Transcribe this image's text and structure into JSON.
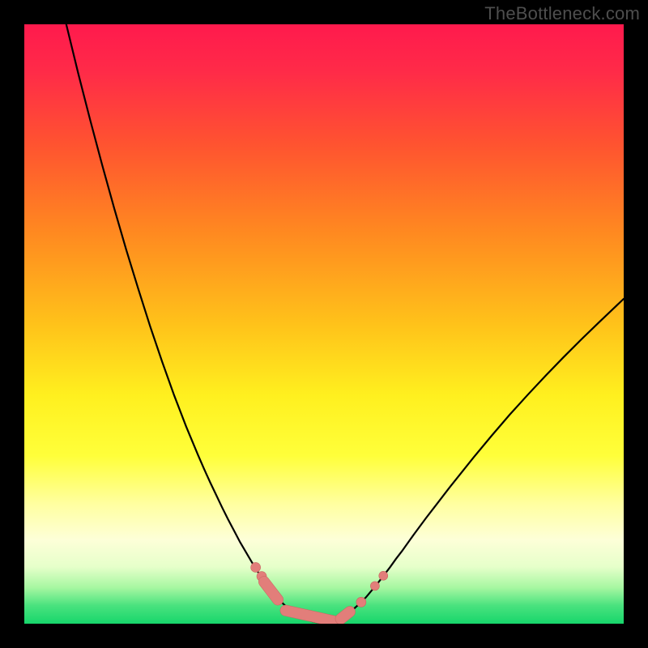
{
  "watermark": "TheBottleneck.com",
  "colors": {
    "frame": "#000000",
    "gradient_stops": [
      {
        "offset": 0.0,
        "color": "#ff1a4d"
      },
      {
        "offset": 0.08,
        "color": "#ff2b48"
      },
      {
        "offset": 0.2,
        "color": "#ff5330"
      },
      {
        "offset": 0.35,
        "color": "#ff8a20"
      },
      {
        "offset": 0.5,
        "color": "#ffc21a"
      },
      {
        "offset": 0.62,
        "color": "#fff01f"
      },
      {
        "offset": 0.72,
        "color": "#ffff3a"
      },
      {
        "offset": 0.8,
        "color": "#ffffa0"
      },
      {
        "offset": 0.86,
        "color": "#fdffd8"
      },
      {
        "offset": 0.905,
        "color": "#e6ffca"
      },
      {
        "offset": 0.94,
        "color": "#a6f7a1"
      },
      {
        "offset": 0.97,
        "color": "#49e27e"
      },
      {
        "offset": 1.0,
        "color": "#17d66b"
      }
    ],
    "curve": "#000000",
    "marker_fill": "#e27e7a",
    "marker_stroke": "#c96560"
  },
  "chart_data": {
    "type": "line",
    "title": "",
    "xlabel": "",
    "ylabel": "",
    "xlim": [
      0,
      100
    ],
    "ylim": [
      0,
      100
    ],
    "curve": [
      {
        "x": 7.0,
        "y": 100.0
      },
      {
        "x": 9.0,
        "y": 91.8
      },
      {
        "x": 11.0,
        "y": 84.0
      },
      {
        "x": 13.0,
        "y": 76.5
      },
      {
        "x": 15.0,
        "y": 69.3
      },
      {
        "x": 17.0,
        "y": 62.4
      },
      {
        "x": 19.0,
        "y": 55.9
      },
      {
        "x": 21.0,
        "y": 49.6
      },
      {
        "x": 23.0,
        "y": 43.7
      },
      {
        "x": 25.0,
        "y": 38.1
      },
      {
        "x": 27.0,
        "y": 32.9
      },
      {
        "x": 29.0,
        "y": 28.1
      },
      {
        "x": 30.0,
        "y": 25.8
      },
      {
        "x": 31.0,
        "y": 23.6
      },
      {
        "x": 32.0,
        "y": 21.5
      },
      {
        "x": 33.0,
        "y": 19.4
      },
      {
        "x": 34.0,
        "y": 17.4
      },
      {
        "x": 35.0,
        "y": 15.5
      },
      {
        "x": 36.0,
        "y": 13.6
      },
      {
        "x": 37.0,
        "y": 11.9
      },
      {
        "x": 38.0,
        "y": 10.2
      },
      {
        "x": 39.0,
        "y": 8.6
      },
      {
        "x": 40.0,
        "y": 7.2
      },
      {
        "x": 41.0,
        "y": 5.8
      },
      {
        "x": 42.0,
        "y": 4.6
      },
      {
        "x": 43.0,
        "y": 3.5
      },
      {
        "x": 44.0,
        "y": 2.6
      },
      {
        "x": 45.0,
        "y": 1.8
      },
      {
        "x": 46.0,
        "y": 1.2
      },
      {
        "x": 47.0,
        "y": 0.7
      },
      {
        "x": 48.0,
        "y": 0.4
      },
      {
        "x": 49.0,
        "y": 0.2
      },
      {
        "x": 50.0,
        "y": 0.2
      },
      {
        "x": 51.0,
        "y": 0.3
      },
      {
        "x": 52.0,
        "y": 0.6
      },
      {
        "x": 53.0,
        "y": 1.1
      },
      {
        "x": 54.0,
        "y": 1.7
      },
      {
        "x": 55.0,
        "y": 2.5
      },
      {
        "x": 56.0,
        "y": 3.4
      },
      {
        "x": 57.0,
        "y": 4.4
      },
      {
        "x": 58.0,
        "y": 5.6
      },
      {
        "x": 59.0,
        "y": 6.8
      },
      {
        "x": 60.0,
        "y": 8.1
      },
      {
        "x": 61.0,
        "y": 9.4
      },
      {
        "x": 62.0,
        "y": 10.8
      },
      {
        "x": 63.0,
        "y": 12.1
      },
      {
        "x": 65.0,
        "y": 14.9
      },
      {
        "x": 67.0,
        "y": 17.6
      },
      {
        "x": 69.0,
        "y": 20.2
      },
      {
        "x": 71.0,
        "y": 22.8
      },
      {
        "x": 73.0,
        "y": 25.3
      },
      {
        "x": 75.0,
        "y": 27.8
      },
      {
        "x": 78.0,
        "y": 31.4
      },
      {
        "x": 81.0,
        "y": 34.9
      },
      {
        "x": 84.0,
        "y": 38.2
      },
      {
        "x": 87.0,
        "y": 41.4
      },
      {
        "x": 90.0,
        "y": 44.5
      },
      {
        "x": 93.0,
        "y": 47.5
      },
      {
        "x": 96.0,
        "y": 50.4
      },
      {
        "x": 100.0,
        "y": 54.2
      }
    ],
    "markers_round": [
      {
        "x": 38.6,
        "y": 9.4,
        "r": 6
      },
      {
        "x": 39.6,
        "y": 7.9,
        "r": 6
      },
      {
        "x": 56.2,
        "y": 3.6,
        "r": 6
      },
      {
        "x": 58.5,
        "y": 6.3,
        "r": 5.5
      },
      {
        "x": 59.9,
        "y": 8.0,
        "r": 5.5
      }
    ],
    "markers_capsule": [
      {
        "x1": 40.0,
        "y1": 7.0,
        "x2": 42.3,
        "y2": 4.0,
        "r": 6.5
      },
      {
        "x1": 43.6,
        "y1": 2.2,
        "x2": 51.8,
        "y2": 0.4,
        "r": 6.5
      },
      {
        "x1": 52.8,
        "y1": 0.8,
        "x2": 54.3,
        "y2": 2.0,
        "r": 6.5
      }
    ]
  }
}
